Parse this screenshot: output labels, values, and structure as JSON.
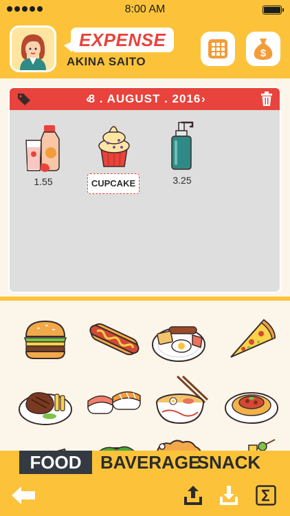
{
  "status_bar": {
    "time": "8:00 AM"
  },
  "header": {
    "title": "EXPENSE",
    "user_name": "AKINA SAITO"
  },
  "card": {
    "date": "8 . AUGUST . 2016",
    "prev_arrow": "‹",
    "next_arrow": "›",
    "items": [
      {
        "icon": "milk-and-juice-icon",
        "amount": "1.55"
      },
      {
        "icon": "cupcake-icon",
        "label": "CUPCAKE"
      },
      {
        "icon": "soap-bottle-icon",
        "amount": "3.25"
      }
    ]
  },
  "foods": [
    "burger-icon",
    "hotdog-icon",
    "breakfast-plate-icon",
    "pizza-slice-icon",
    "steak-plate-icon",
    "sushi-icon",
    "noodle-bowl-icon",
    "spaghetti-icon",
    "sandwich-icon",
    "salad-icon",
    "roast-chicken-icon",
    "skewer-icon"
  ],
  "tabs": [
    {
      "label": "FOOD",
      "active": true
    },
    {
      "label": "BAVERAGE",
      "active": false
    },
    {
      "label": "SNACK",
      "active": false
    }
  ],
  "colors": {
    "accent_yellow": "#fcc33a",
    "accent_red": "#e8433c",
    "dark": "#333a41"
  }
}
